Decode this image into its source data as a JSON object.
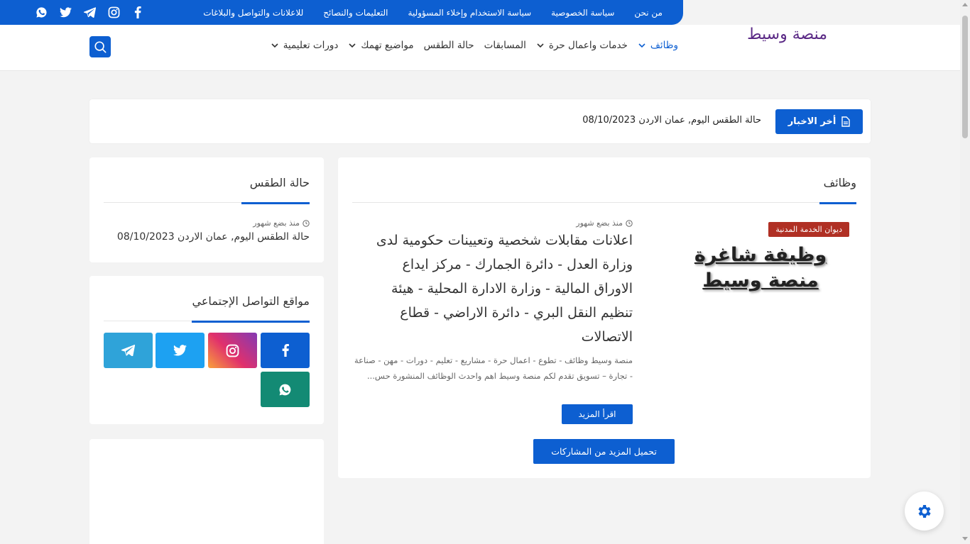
{
  "topbar": {
    "links": [
      "من نحن",
      "سياسة الخصوصية",
      "سياسة الاستخدام وإخلاء المسؤولية",
      "التعليمات والنصائح",
      "للاعلانات والتواصل والبلاغات"
    ],
    "social_icons": [
      "whatsapp-icon",
      "twitter-icon",
      "telegram-icon",
      "instagram-icon",
      "facebook-icon"
    ]
  },
  "header": {
    "logo": "منصة وسيط",
    "nav": [
      {
        "label": "وظائف",
        "dropdown": true,
        "active": true
      },
      {
        "label": "خدمات واعمال حرة",
        "dropdown": true,
        "active": false
      },
      {
        "label": "المسابقات",
        "dropdown": false,
        "active": false
      },
      {
        "label": "حالة الطقس",
        "dropdown": false,
        "active": false
      },
      {
        "label": "مواضيع تهمك",
        "dropdown": true,
        "active": false
      },
      {
        "label": "دورات تعليمية",
        "dropdown": true,
        "active": false
      }
    ]
  },
  "ticker": {
    "label": "أخر الاخبار",
    "text": "حالة الطقس اليوم, عمان الاردن 08/10/2023"
  },
  "main": {
    "section_title": "وظائف",
    "post": {
      "thumb_badge": "ديوان الخدمة المدنية",
      "thumb_line1": "وظيفة شاغرة",
      "thumb_line2": "منصة وسيط",
      "meta": "منذ بضع شهور",
      "title": "اعلانات مقابلات شخصية وتعيينات حكومية لدى وزارة العدل - دائرة الجمارك - مركز ايداع الاوراق المالية - وزارة الادارة المحلية - هيئة تنظيم النقل البري - دائرة الاراضي - قطاع الاتصالات",
      "excerpt": "منصة وسيط وظائف - تطوع - اعمال حرة - مشاريع - تعليم - دورات - مهن - صناعة - تجارة – تسويق تقدم لكم منصة وسيط اهم واحدث الوظائف المنشورة حس...",
      "read_more": "اقرأ المزيد"
    },
    "load_more": "تحميل المزيد من المشاركات"
  },
  "sidebar": {
    "weather": {
      "title": "حالة الطقس",
      "meta": "منذ بضع شهور",
      "text": "حالة الطقس اليوم, عمان الاردن 08/10/2023"
    },
    "social": {
      "title": "مواقع التواصل الإجتماعي",
      "buttons": [
        {
          "icon": "facebook-icon",
          "color": "#0d5fd1"
        },
        {
          "icon": "instagram-icon",
          "color": "#c13584"
        },
        {
          "icon": "twitter-icon",
          "color": "#1da1f2"
        },
        {
          "icon": "telegram-icon",
          "color": "#2fa3d9"
        },
        {
          "icon": "whatsapp-icon",
          "color": "#138a74"
        }
      ]
    }
  },
  "colors": {
    "primary": "#0d5fd1",
    "logo": "#5b2a86",
    "badge": "#b03024"
  }
}
